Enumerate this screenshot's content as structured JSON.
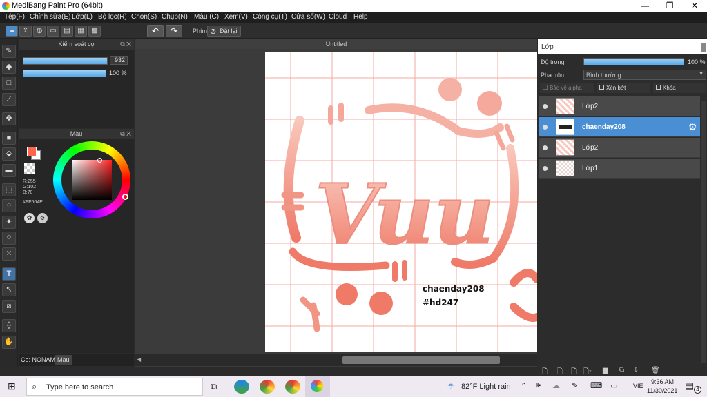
{
  "window": {
    "title": "MediBang Paint Pro (64bit)",
    "minimize": "—",
    "restore": "❐",
    "close": "✕"
  },
  "menu": [
    "Tệp(F)",
    "Chỉnh sửa(E)",
    "Lớp(L)",
    "Bộ lọc(R)",
    "Chọn(S)",
    "Chụp(N)",
    "Màu (C)",
    "Xem(V)",
    "Công cụ(T)",
    "Cửa sổ(W)",
    "Cloud",
    "Help"
  ],
  "toolbar": {
    "phim_label": "Phím",
    "reset_label": "Đặt lại"
  },
  "brush_panel": {
    "title": "Kiểm soát cọ",
    "size_value": "932",
    "opacity_value": "100 %",
    "size_fill": 1.0,
    "opacity_fill": 1.0
  },
  "color_panel": {
    "title": "Màu",
    "r": "R:255",
    "g": "G:102",
    "b": "B:78",
    "hex": "#FF664E",
    "color": "#FF664E"
  },
  "bottom_tabs": {
    "brush_tab": "Co: NONAME",
    "color_tab": "Màu"
  },
  "canvas": {
    "doc_title": "Untitled",
    "text_line1": "chaenday208",
    "text_line2": "#hd247",
    "big_text": "Vuu"
  },
  "layer_panel": {
    "title": "Lớp",
    "opacity_label": "Độ trong",
    "opacity_value": "100 %",
    "opacity_fill": 1.0,
    "blend_label": "Pha trộn",
    "blend_value": "Bình thường",
    "protect_alpha": "Bảo vệ alpha",
    "clipping": "Xén bớt",
    "lock": "Khóa",
    "layers": [
      {
        "name": "Lớp2",
        "selected": false
      },
      {
        "name": "chaenday208",
        "selected": true
      },
      {
        "name": "Lớp2",
        "selected": false
      },
      {
        "name": "Lớp1",
        "selected": false
      }
    ]
  },
  "taskbar": {
    "search_placeholder": "Type here to search",
    "weather": "82°F  Light rain",
    "lang": "VIE",
    "time": "9:36 AM",
    "date": "11/30/2021",
    "notifications": "4"
  }
}
